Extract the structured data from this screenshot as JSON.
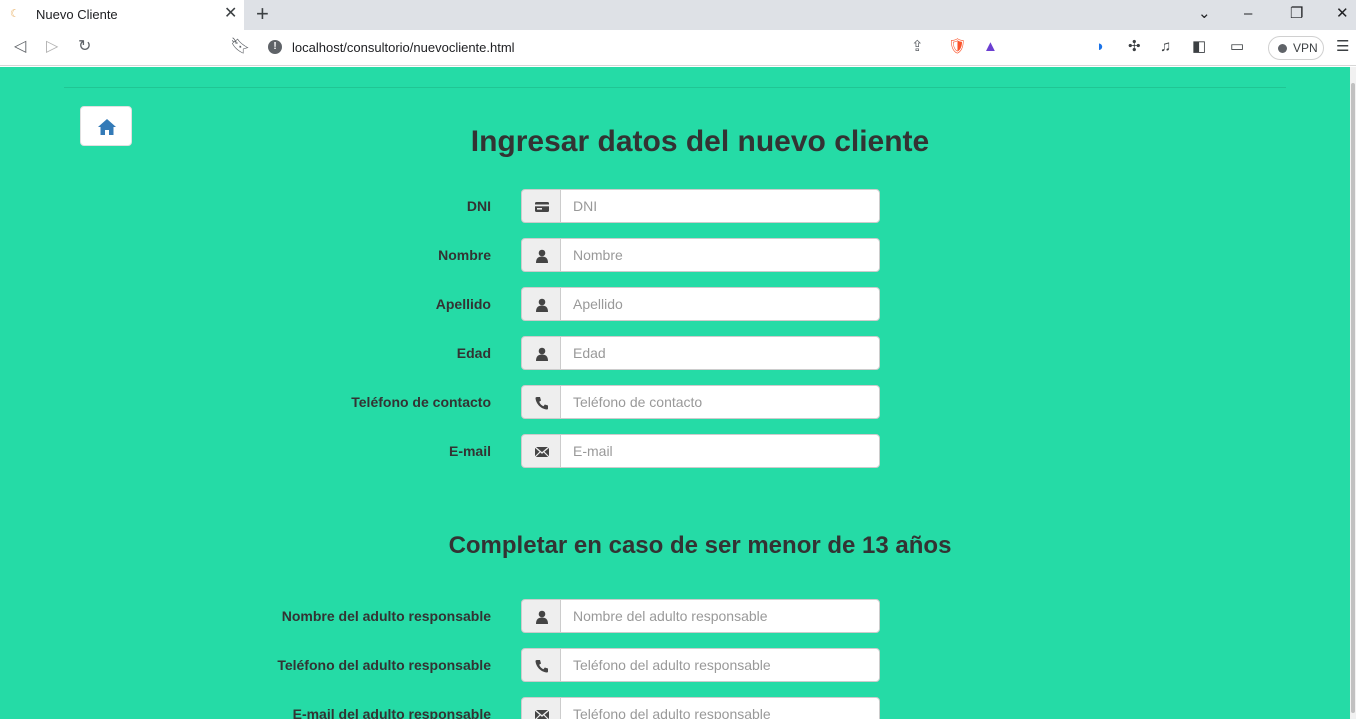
{
  "browser": {
    "tab_title": "Nuevo Cliente",
    "url": "localhost/consultorio/nuevocliente.html",
    "vpn_label": "VPN"
  },
  "page": {
    "title": "Ingresar datos del nuevo cliente",
    "minor_section_title": "Completar en caso de ser menor de 13 años"
  },
  "form": {
    "dni": {
      "label": "DNI",
      "placeholder": "DNI",
      "icon": "id-card-icon"
    },
    "nombre": {
      "label": "Nombre",
      "placeholder": "Nombre",
      "icon": "user-icon"
    },
    "apellido": {
      "label": "Apellido",
      "placeholder": "Apellido",
      "icon": "user-icon"
    },
    "edad": {
      "label": "Edad",
      "placeholder": "Edad",
      "icon": "user-icon"
    },
    "telefono": {
      "label": "Teléfono de contacto",
      "placeholder": "Teléfono de contacto",
      "icon": "phone-icon"
    },
    "email": {
      "label": "E-mail",
      "placeholder": "E-mail",
      "icon": "envelope-icon"
    }
  },
  "guardian_form": {
    "nombre": {
      "label": "Nombre del adulto responsable",
      "placeholder": "Nombre del adulto responsable",
      "icon": "user-icon"
    },
    "telefono": {
      "label": "Teléfono del adulto responsable",
      "placeholder": "Teléfono del adulto responsable",
      "icon": "phone-icon"
    },
    "email": {
      "label": "E-mail del adulto responsable",
      "placeholder": "Teléfono del adulto responsable",
      "icon": "envelope-icon"
    }
  },
  "colors": {
    "page_background": "#25dba6",
    "home_icon": "#337ab7",
    "text": "#333333"
  }
}
